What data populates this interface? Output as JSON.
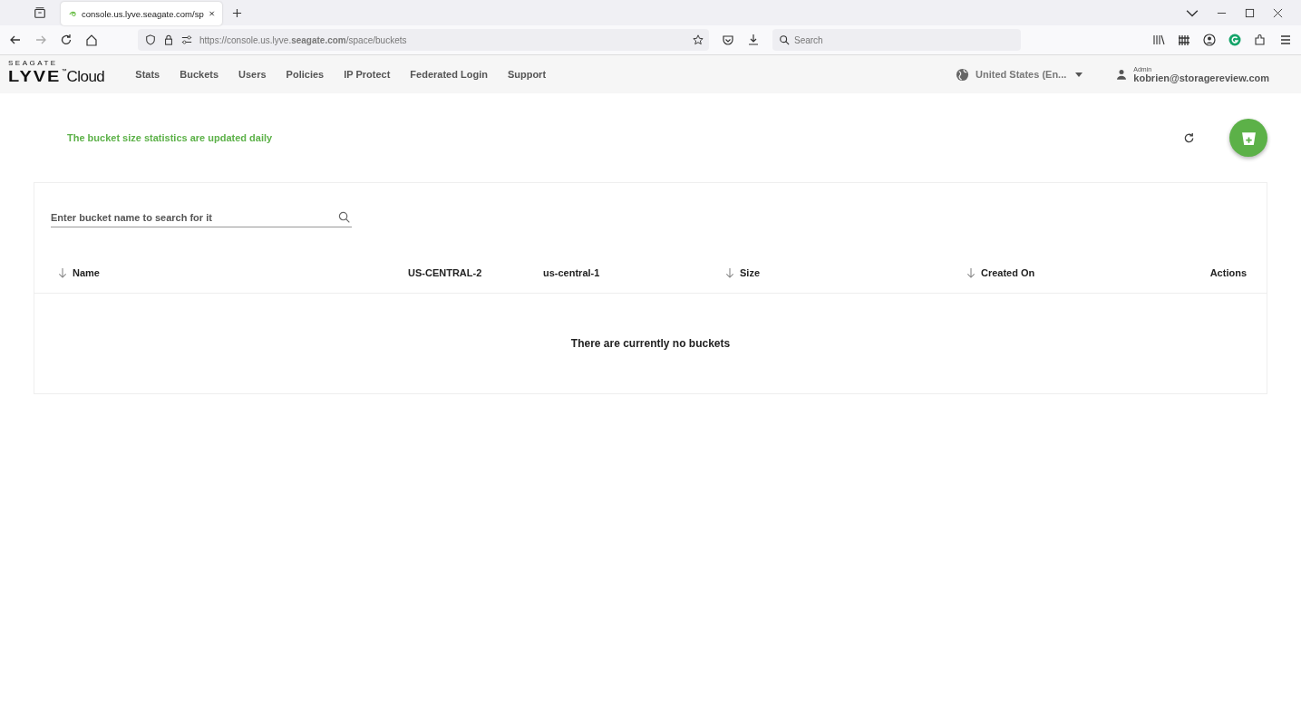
{
  "browser": {
    "tabs": [
      {
        "title": "console.us.lyve.seagate.com/sp",
        "selected": true
      }
    ],
    "url": "https://console.us.lyve.**seagate.com**/space/buckets",
    "search": {
      "placeholder": "Search"
    }
  },
  "header": {
    "logo": {
      "maker": "SEAGATE",
      "name": "LYVE",
      "tm": "™",
      "product": "Cloud"
    },
    "nav": [
      {
        "label": "Stats"
      },
      {
        "label": "Buckets"
      },
      {
        "label": "Users"
      },
      {
        "label": "Policies"
      },
      {
        "label": "IP Protect"
      },
      {
        "label": "Federated Login"
      },
      {
        "label": "Support"
      }
    ],
    "region": "United States (En...",
    "user": {
      "role": "Admin",
      "email": "kobrien@storagereview.com"
    }
  },
  "notice": "The bucket size statistics are updated daily",
  "search": {
    "placeholder": "Enter bucket name to search for it"
  },
  "table": {
    "columns": [
      {
        "label": "Name",
        "sortable": true
      },
      {
        "label": "US-CENTRAL-2",
        "sortable": false
      },
      {
        "label": "us-central-1",
        "sortable": false
      },
      {
        "label": "Size",
        "sortable": true
      },
      {
        "label": "Created On",
        "sortable": true
      },
      {
        "label": "Actions",
        "sortable": false
      }
    ],
    "empty": "There are currently no buckets"
  }
}
